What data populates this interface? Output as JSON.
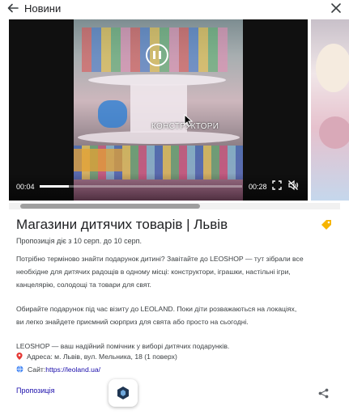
{
  "topbar": {
    "title": "Новини",
    "back_icon": "arrow-left-icon",
    "close_icon": "close-icon"
  },
  "video": {
    "overlay_label": "КОНСТРУКТОРИ",
    "current_time": "00:04",
    "total_time": "00:28",
    "progress": 0.143,
    "state": "playing",
    "icons": [
      "pause-icon",
      "fullscreen-icon",
      "mute-icon"
    ]
  },
  "carousel": {
    "scroll_position": 0.03,
    "scroll_visible_fraction": 0.54
  },
  "ad": {
    "title": "Магазини дитячих товарів | Львів",
    "validity": "Пропозиція діє з 10 серп. до 10 серп.",
    "paragraph_1": "Потрібно терміново знайти подарунок дитині? Завітайте до LEOSHOP — тут зібрали все необхідне для дитячих радощів в одному місці: конструктори, іграшки, настільні ігри, канцелярію, солодощі та товари для свят.",
    "paragraph_2": "Обирайте подарунок під час візиту до LEOLAND. Поки діти розважаються на локаціях, ви легко знайдете приємний сюрприз для свята або просто на сьогодні.",
    "paragraph_3": "LEOSHOP — ваш надійний помічник у виборі дитячих подарунків.",
    "address_line": "Адреса: м. Львів, вул. Мельника, 18 (1 поверх)",
    "site_label": "Сайт:",
    "site_url": "https://leoland.ua/",
    "sponsored_label": "Пропозиція",
    "colors": {
      "link": "#1a0dab",
      "tag": "#f6b400",
      "pin": "#e53935",
      "globe": "#4285f4"
    }
  }
}
